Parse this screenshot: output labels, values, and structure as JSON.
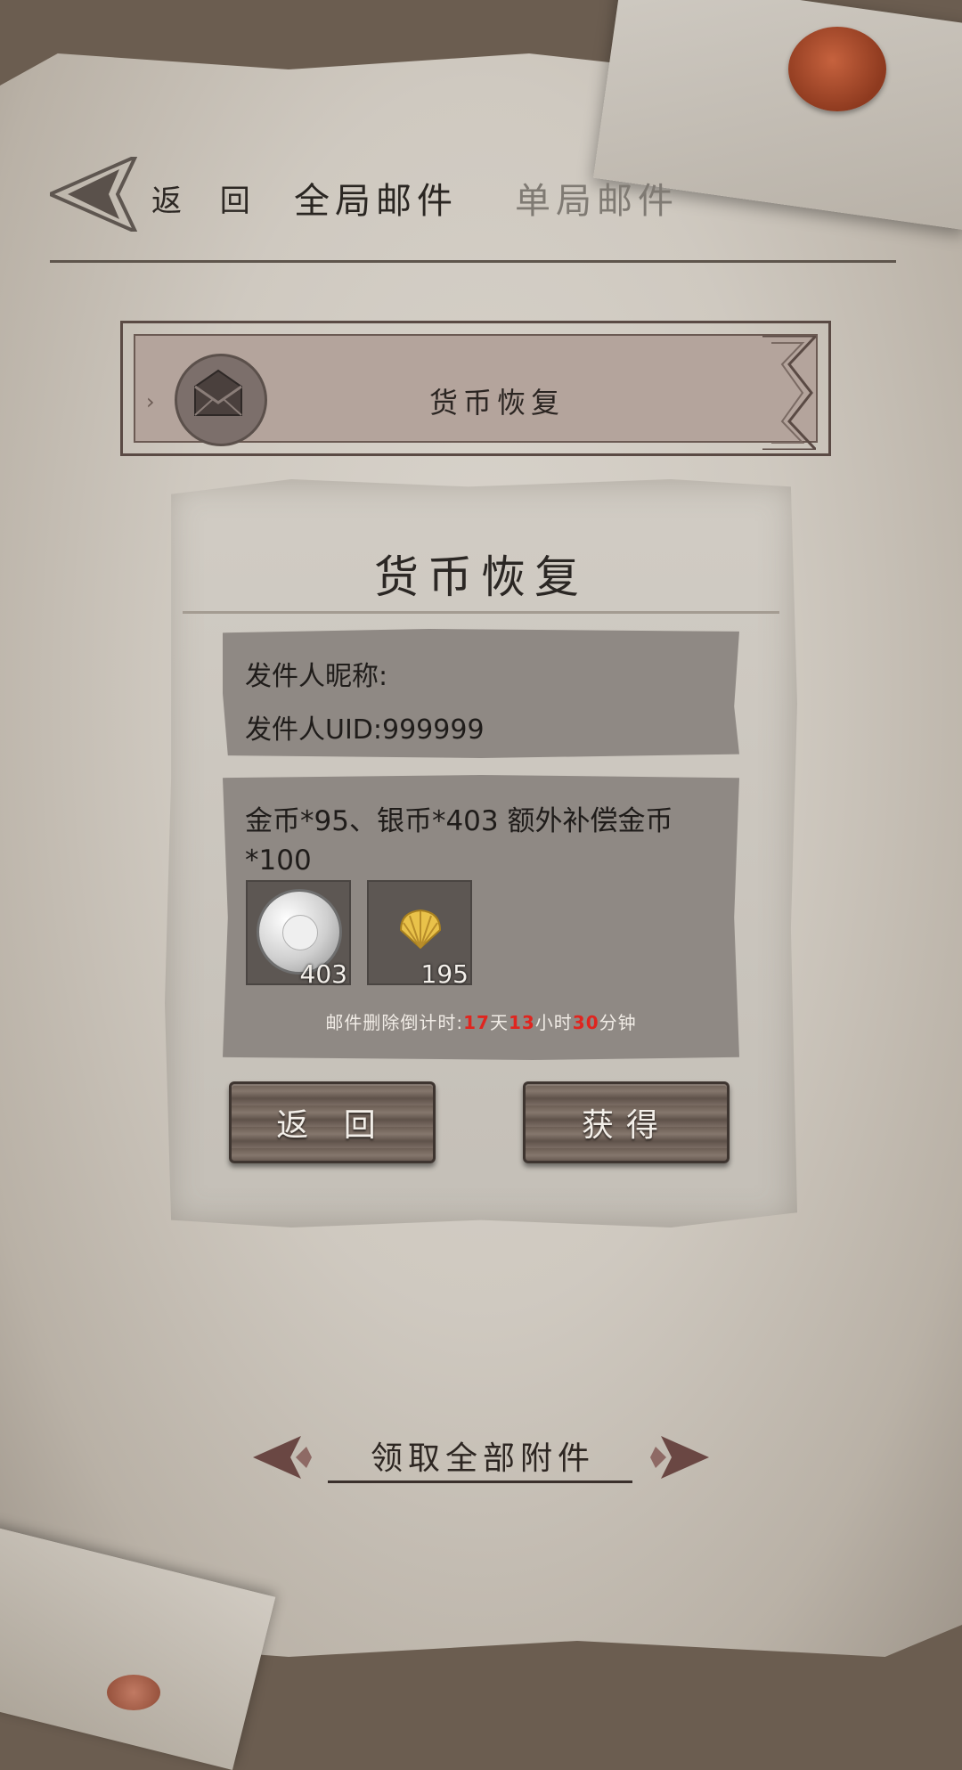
{
  "header": {
    "back_label": "返 回",
    "tabs": [
      {
        "label": "全局邮件",
        "active": true
      },
      {
        "label": "单局邮件",
        "active": false
      }
    ]
  },
  "mail_list": [
    {
      "title": "货币恢复"
    }
  ],
  "dialog": {
    "title": "货币恢复",
    "sender_name_label": "发件人昵称:",
    "sender_uid_label": "发件人UID:999999",
    "content": "金币*95、银币*403 额外补偿金币*100",
    "items": [
      {
        "icon": "silver-coin-icon",
        "count": "403"
      },
      {
        "icon": "shell-icon",
        "count": "195"
      }
    ],
    "countdown": {
      "prefix": "邮件删除倒计时:",
      "days": "17",
      "days_unit": "天",
      "hours": "13",
      "hours_unit": "小时",
      "minutes": "30",
      "minutes_unit": "分钟"
    },
    "buttons": {
      "back_label": "返 回",
      "get_label": "获得"
    }
  },
  "footer": {
    "claim_all_label": "领取全部附件"
  },
  "colors": {
    "countdown_highlight": "#e0251f",
    "panel_bg": "#8f8984",
    "wax_seal": "#b5502f"
  }
}
